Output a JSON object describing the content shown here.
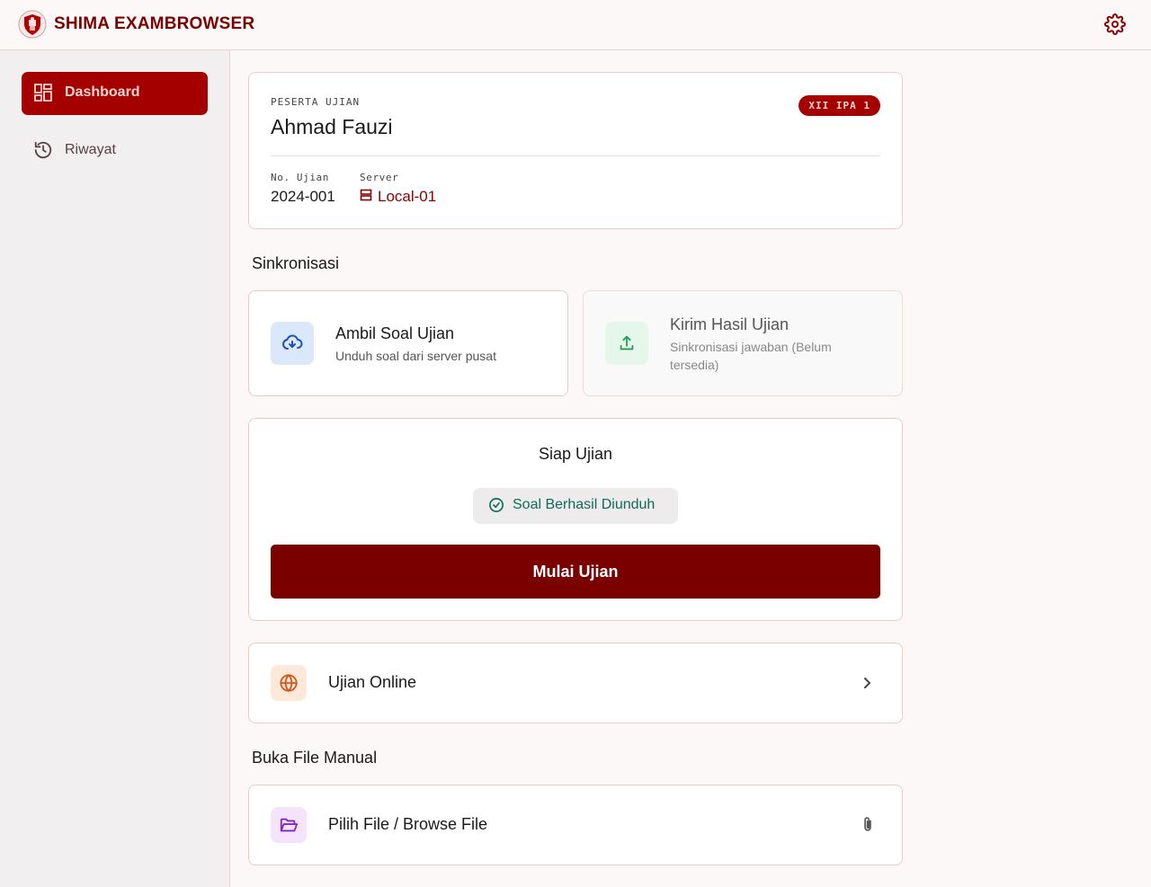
{
  "header": {
    "app_title": "SHIMA EXAMBROWSER",
    "logo_icon": "school-shield-logo",
    "settings_icon": "gear-icon"
  },
  "sidebar": {
    "items": [
      {
        "label": "Dashboard",
        "icon": "dashboard-icon",
        "active": true
      },
      {
        "label": "Riwayat",
        "icon": "history-icon",
        "active": false
      }
    ]
  },
  "profile": {
    "label": "PESERTA UJIAN",
    "name": "Ahmad Fauzi",
    "class_badge": "XII IPA 1",
    "exam_no_label": "No. Ujian",
    "exam_no": "2024-001",
    "server_label": "Server",
    "server": "Local-01",
    "server_icon": "server-icon"
  },
  "sync": {
    "section_title": "Sinkronisasi",
    "download": {
      "title": "Ambil Soal Ujian",
      "subtitle": "Unduh soal dari server pusat",
      "icon": "cloud-download-icon"
    },
    "upload": {
      "title": "Kirim Hasil Ujian",
      "subtitle": "Sinkronisasi jawaban (Belum tersedia)",
      "icon": "upload-icon",
      "disabled": true
    }
  },
  "ready": {
    "title": "Siap Ujian",
    "status": "Soal Berhasil Diunduh",
    "status_icon": "check-circle-icon",
    "start_label": "Mulai Ujian"
  },
  "online": {
    "label": "Ujian Online",
    "icon": "globe-icon",
    "trail_icon": "chevron-right-icon"
  },
  "manual": {
    "section_title": "Buka File Manual",
    "label": "Pilih File / Browse File",
    "icon": "folder-open-icon",
    "trail_icon": "paperclip-icon"
  },
  "colors": {
    "brand": "#7a0000",
    "accent": "#a40000",
    "success": "#0f6b58"
  }
}
